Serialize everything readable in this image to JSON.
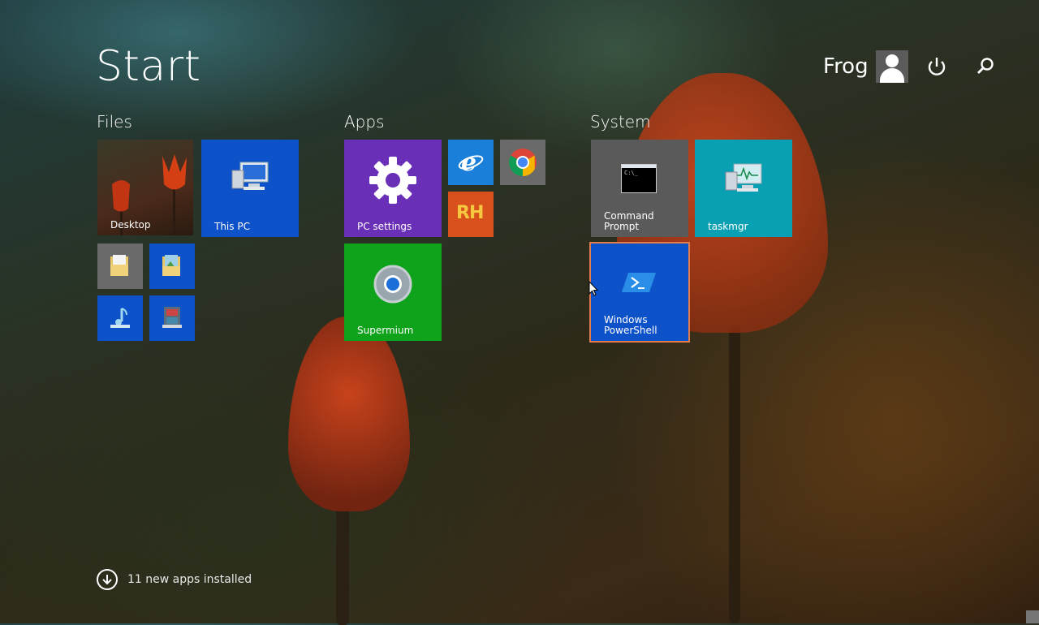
{
  "header": {
    "title": "Start",
    "user_name": "Frog",
    "avatar_icon": "user-icon",
    "power_icon": "power-icon",
    "search_icon": "search-icon"
  },
  "groups": {
    "files": "Files",
    "apps": "Apps",
    "system": "System"
  },
  "tiles": {
    "desktop": "Desktop",
    "this_pc": "This PC",
    "pc_settings": "PC settings",
    "supermium": "Supermium",
    "rh_badge": "RH",
    "command_prompt": "Command Prompt",
    "cmd_prompt_text": "C:\\_",
    "taskmgr": "taskmgr",
    "powershell": "Windows PowerShell"
  },
  "footer": {
    "apps_installed": "11 new apps installed"
  },
  "colors": {
    "blue": "#0e52c9",
    "purple": "#6a2fb7",
    "green": "#0ea31a",
    "teal": "#0aa0b4",
    "gray": "#555555",
    "orange": "#d8501c",
    "selected_border": "#e47b4a"
  }
}
